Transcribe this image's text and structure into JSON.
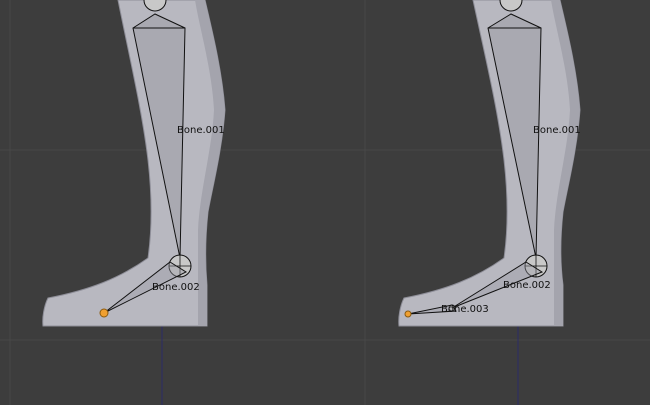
{
  "viewport": {
    "background": "#3d3d3d",
    "grid_color": "#484848",
    "axis_line_color": "#2b2b66"
  },
  "mesh": {
    "fill": "#b8b8c0",
    "edge_shadow": "#8e8e98"
  },
  "bone": {
    "stroke": "#111111",
    "fill_light": "#9c9ca4",
    "joint_fill": "#c8c8c8",
    "selected_color": "#f0a030"
  },
  "left_leg": {
    "bone_upper_label": "Bone.001",
    "bone_foot_label": "Bone.002"
  },
  "right_leg": {
    "bone_upper_label": "Bone.001",
    "bone_foot_label": "Bone.002",
    "bone_toe_label": "Bone.003"
  },
  "icons": {
    "joint": "joint-sphere-icon",
    "tip": "bone-tip-icon"
  }
}
